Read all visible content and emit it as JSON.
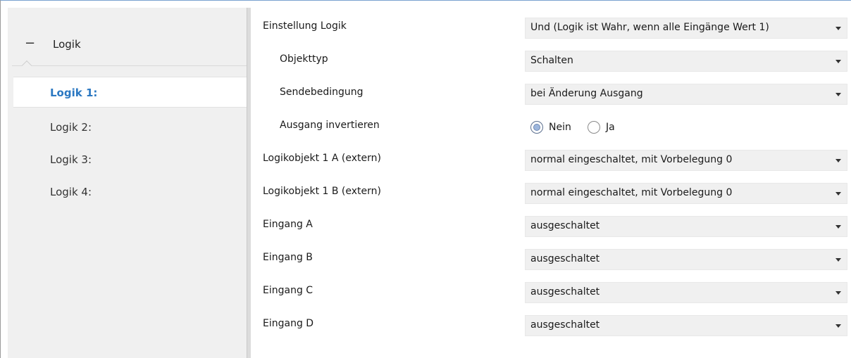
{
  "sidebar": {
    "group_label": "Logik",
    "group_toggle": "−",
    "items": [
      {
        "label": "Logik 1:",
        "active": true
      },
      {
        "label": "Logik 2:",
        "active": false
      },
      {
        "label": "Logik 3:",
        "active": false
      },
      {
        "label": "Logik 4:",
        "active": false
      }
    ]
  },
  "params": {
    "einstellung_logik": {
      "label": "Einstellung Logik",
      "value": "Und (Logik ist Wahr, wenn alle Eingänge Wert 1)"
    },
    "objekttyp": {
      "label": "Objekttyp",
      "value": "Schalten"
    },
    "sendebedingung": {
      "label": "Sendebedingung",
      "value": "bei Änderung Ausgang"
    },
    "ausgang_invertieren": {
      "label": "Ausgang invertieren",
      "option_no": "Nein",
      "option_yes": "Ja",
      "selected": "Nein"
    },
    "logikobjekt_1a": {
      "label": "Logikobjekt 1 A (extern)",
      "value": "normal eingeschaltet, mit Vorbelegung 0"
    },
    "logikobjekt_1b": {
      "label": "Logikobjekt 1 B (extern)",
      "value": "normal eingeschaltet, mit Vorbelegung 0"
    },
    "eingang_a": {
      "label": "Eingang A",
      "value": "ausgeschaltet"
    },
    "eingang_b": {
      "label": "Eingang B",
      "value": "ausgeschaltet"
    },
    "eingang_c": {
      "label": "Eingang C",
      "value": "ausgeschaltet"
    },
    "eingang_d": {
      "label": "Eingang D",
      "value": "ausgeschaltet"
    }
  },
  "colors": {
    "accent": "#2b78c2",
    "sidebar_bg": "#f0f0f0",
    "select_bg": "#f0f0f0"
  }
}
